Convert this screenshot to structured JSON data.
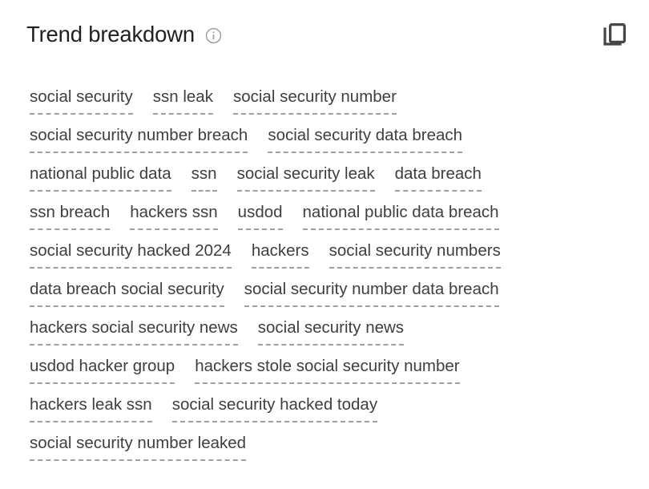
{
  "header": {
    "title": "Trend breakdown",
    "info_icon": "info-circle-icon",
    "copy_icon": "copy-icon"
  },
  "terms": {
    "rows": [
      [
        "social security",
        "ssn leak",
        "social security number"
      ],
      [
        "social security number breach",
        "social security data breach"
      ],
      [
        "national public data",
        "ssn",
        "social security leak",
        "data breach"
      ],
      [
        "ssn breach",
        "hackers ssn",
        "usdod",
        "national public data breach"
      ],
      [
        "social security hacked 2024",
        "hackers",
        "social security numbers"
      ],
      [
        "data breach social security",
        "social security number data breach"
      ],
      [
        "hackers social security news",
        "social security news"
      ],
      [
        "usdod hacker group",
        "hackers stole social security number"
      ],
      [
        "hackers leak ssn",
        "social security hacked today"
      ],
      [
        "social security number leaked"
      ]
    ]
  },
  "colors": {
    "title": "#202124",
    "term_text": "#3c4043",
    "underline": "#9aa0a6",
    "icon": "#5f6368",
    "background": "#ffffff"
  }
}
